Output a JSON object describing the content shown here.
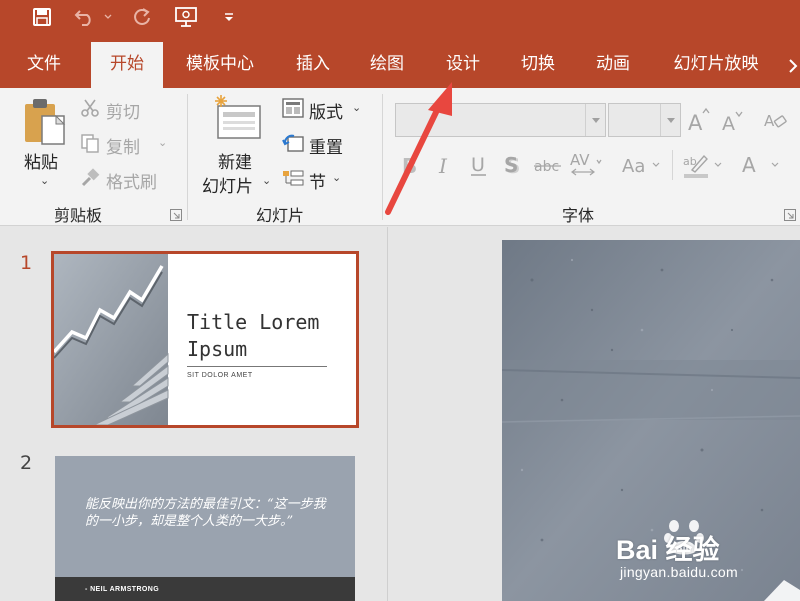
{
  "ribbon_tabs": [
    {
      "label": "文件",
      "active": false
    },
    {
      "label": "开始",
      "active": true
    },
    {
      "label": "模板中心",
      "active": false
    },
    {
      "label": "插入",
      "active": false
    },
    {
      "label": "绘图",
      "active": false
    },
    {
      "label": "设计",
      "active": false
    },
    {
      "label": "切换",
      "active": false
    },
    {
      "label": "动画",
      "active": false
    },
    {
      "label": "幻灯片放映",
      "active": false
    }
  ],
  "clipboard": {
    "paste": "粘贴",
    "cut": "剪切",
    "copy": "复制",
    "format_painter": "格式刷",
    "group_label": "剪贴板"
  },
  "slides_group": {
    "new_slide_line1": "新建",
    "new_slide_line2": "幻灯片",
    "layout": "版式",
    "reset": "重置",
    "section": "节",
    "group_label": "幻灯片"
  },
  "font_group": {
    "group_label": "字体",
    "font_name_value": "",
    "font_size_value": ""
  },
  "thumbnails": [
    {
      "number": "1",
      "selected": true,
      "title": "Title Lorem Ipsum",
      "subtitle": "SIT DOLOR AMET"
    },
    {
      "number": "2",
      "selected": false,
      "quote": "能反映出你的方法的最佳引文：“这一步我的一小步，却是整个人类的一大步。”",
      "author": "- NEIL ARMSTRONG"
    }
  ],
  "watermark": {
    "brand": "Bai  经验",
    "url": "jingyan.baidu.com"
  },
  "colors": {
    "accent": "#b7472a",
    "ribbon_bg": "#f3f3f3",
    "arrow": "#e8473f"
  }
}
